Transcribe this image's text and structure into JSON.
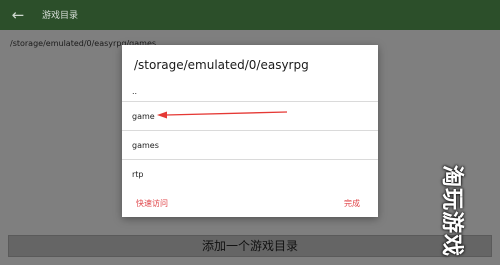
{
  "app_bar": {
    "back_icon": "←",
    "title": "游戏目录"
  },
  "background_path": "/storage/emulated/0/easyrpg/games",
  "dialog": {
    "title": "/storage/emulated/0/easyrpg",
    "parent_entry": "..",
    "entries": [
      "game",
      "games",
      "rtp"
    ],
    "quick_access_label": "快速访问",
    "done_label": "完成"
  },
  "add_button_label": "添加一个游戏目录",
  "watermark": "淘玩游戏",
  "colors": {
    "app_bar": "#2c4f2a",
    "accent": "#e0464a",
    "annotation_arrow": "#e53935",
    "overlay": "#7f7f7f"
  }
}
